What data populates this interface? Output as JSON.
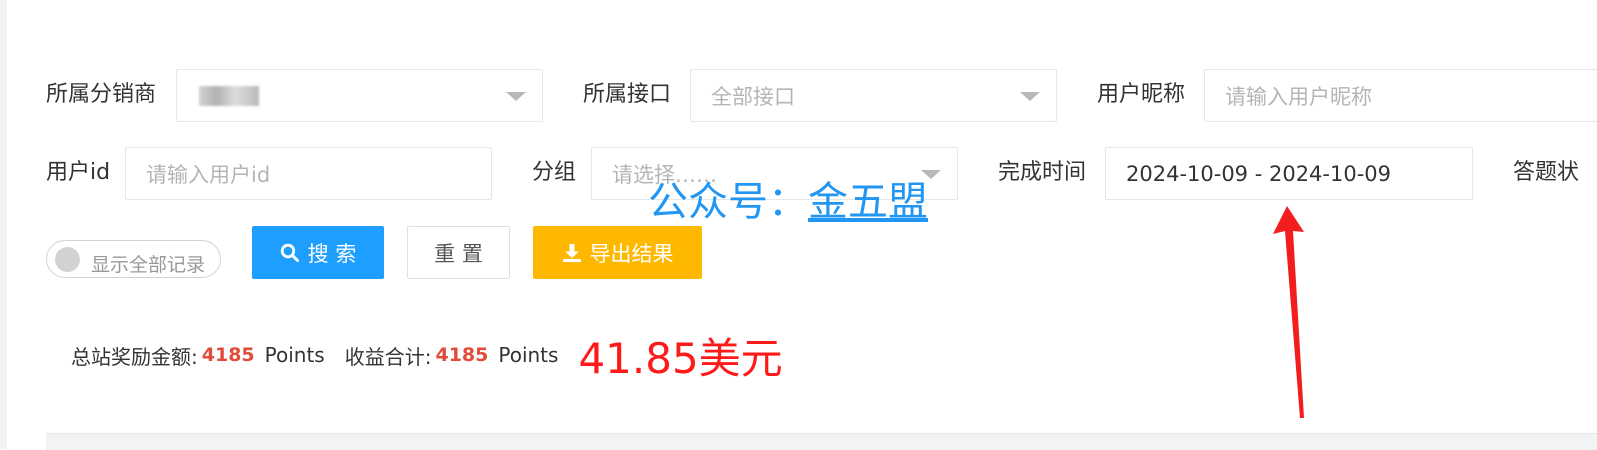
{
  "filters": {
    "distributor": {
      "label": "所属分销商",
      "value": "",
      "obscured": true
    },
    "api": {
      "label": "所属接口",
      "placeholder": "全部接口"
    },
    "nickname": {
      "label": "用户昵称",
      "placeholder": "请输入用户昵称"
    },
    "user_id": {
      "label": "用户id",
      "placeholder": "请输入用户id"
    },
    "group": {
      "label": "分组",
      "placeholder": "请选择……"
    },
    "finish_time": {
      "label": "完成时间",
      "value": "2024-10-09 - 2024-10-09"
    },
    "answer_status": {
      "label": "答题状"
    }
  },
  "toggle": {
    "label": "显示全部记录",
    "on": false
  },
  "buttons": {
    "search": "搜 索",
    "reset": "重 置",
    "export": "导出结果"
  },
  "watermark": {
    "prefix": "公众号：",
    "name": "金五盟"
  },
  "stats": {
    "total_reward_label": "总站奖励金额:",
    "total_reward_value": "4185",
    "total_reward_unit": "Points",
    "income_label": "收益合计:",
    "income_value": "4185",
    "income_unit": "Points",
    "usd_value": "41.85美元"
  },
  "colors": {
    "search": "#1e9fff",
    "export": "#ffb800",
    "stat_number": "#e04b3a",
    "usd": "#ff1a1a",
    "watermark": "#2196f3",
    "annotation_arrow": "#f21e1e"
  }
}
